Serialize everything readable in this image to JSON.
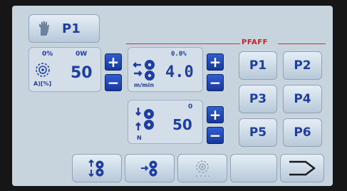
{
  "header": {
    "program_label": "P1",
    "icon": "hand-icon"
  },
  "brand": {
    "text": "PFAFF",
    "color": "#c8202a"
  },
  "stitch_panel": {
    "top_left": "0%",
    "top_right": "0W",
    "value": "50",
    "unit": "A)[%]",
    "icon": "bobbin-winder-icon"
  },
  "speed_panel": {
    "top_value": "0.0%",
    "value": "4.0",
    "unit": "m/min",
    "icon": "roller-feed-icon"
  },
  "tension_panel": {
    "top_value": "0",
    "value": "50",
    "unit": "N",
    "icon": "roller-pressure-icon"
  },
  "controls": {
    "plus": "+",
    "minus": "−"
  },
  "programs": [
    "P1",
    "P2",
    "P3",
    "P4",
    "P5",
    "P6"
  ],
  "bottom_bar": {
    "icons": [
      "roller-lift-icon",
      "roller-advance-icon",
      "winder-inactive-icon",
      "blank",
      "next-arrow-icon"
    ]
  },
  "colors": {
    "screen_bg": "#c7d4de",
    "accent_blue": "#1f3e9f",
    "button_blue": "#2448b5"
  }
}
